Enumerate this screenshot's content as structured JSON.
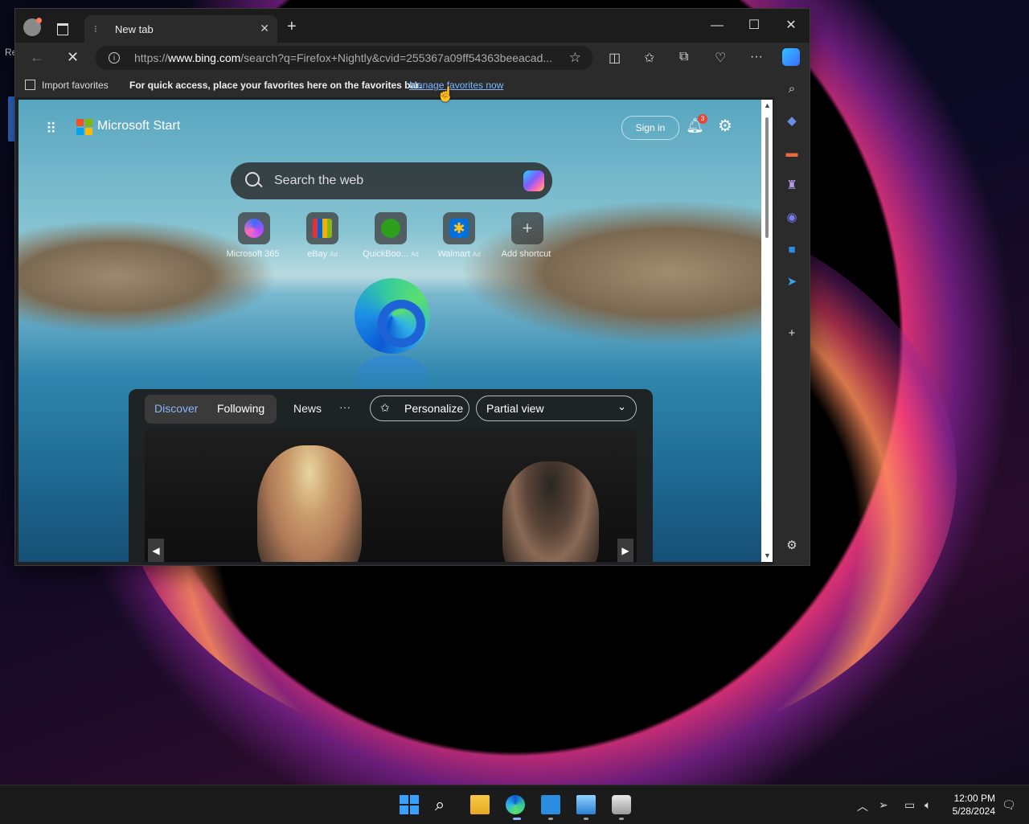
{
  "desktop": {
    "label": "Re"
  },
  "browser": {
    "tab_title": "New tab",
    "url_prefix": "https://",
    "url_domain": "www.bing.com",
    "url_rest": "/search?q=Firefox+Nightly&cvid=255367a09ff54363beeacad...",
    "favorites_bar": {
      "import_label": "Import favorites",
      "message": "For quick access, place your favorites here on the favorites bar.",
      "link": "Manage favorites now"
    }
  },
  "start_page": {
    "brand": "Microsoft Start",
    "sign_in": "Sign in",
    "notification_count": "3",
    "search_placeholder": "Search the web",
    "shortcuts": [
      {
        "label": "Microsoft 365",
        "ad": ""
      },
      {
        "label": "eBay",
        "ad": "Ad"
      },
      {
        "label": "QuickBoo...",
        "ad": "Ad"
      },
      {
        "label": "Walmart",
        "ad": "Ad"
      },
      {
        "label": "Add shortcut",
        "ad": ""
      }
    ],
    "feed": {
      "tab_discover": "Discover",
      "tab_following": "Following",
      "tab_news": "News",
      "more": "···",
      "personalize": "Personalize",
      "view": "Partial view"
    }
  },
  "taskbar": {
    "time": "12:00 PM",
    "date": "5/28/2024"
  },
  "colors": {
    "accent": "#7cb7ff",
    "discover": "#8ab4f8",
    "badge": "#e0463a"
  }
}
